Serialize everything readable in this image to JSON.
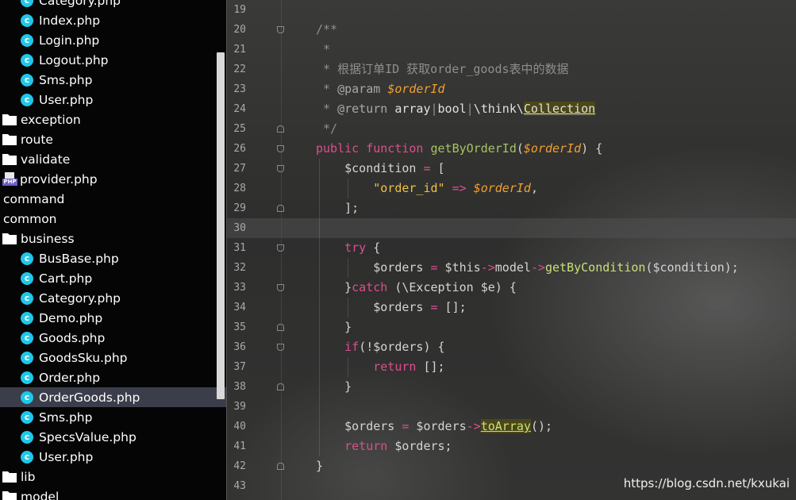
{
  "sidebar": {
    "items": [
      {
        "label": "Category.php",
        "icon": "class-file-icon"
      },
      {
        "label": "Index.php",
        "icon": "class-file-icon"
      },
      {
        "label": "Login.php",
        "icon": "class-file-icon"
      },
      {
        "label": "Logout.php",
        "icon": "class-file-icon"
      },
      {
        "label": "Sms.php",
        "icon": "class-file-icon"
      },
      {
        "label": "User.php",
        "icon": "class-file-icon"
      },
      {
        "label": "exception",
        "icon": "folder-icon"
      },
      {
        "label": "route",
        "icon": "folder-icon"
      },
      {
        "label": "validate",
        "icon": "folder-icon"
      },
      {
        "label": "provider.php",
        "icon": "php-file-icon"
      },
      {
        "label": "command",
        "icon": ""
      },
      {
        "label": "common",
        "icon": ""
      },
      {
        "label": "business",
        "icon": "folder-icon"
      },
      {
        "label": "BusBase.php",
        "icon": "class-file-icon"
      },
      {
        "label": "Cart.php",
        "icon": "class-file-icon"
      },
      {
        "label": "Category.php",
        "icon": "class-file-icon"
      },
      {
        "label": "Demo.php",
        "icon": "class-file-icon"
      },
      {
        "label": "Goods.php",
        "icon": "class-file-icon"
      },
      {
        "label": "GoodsSku.php",
        "icon": "class-file-icon"
      },
      {
        "label": "Order.php",
        "icon": "class-file-icon"
      },
      {
        "label": "OrderGoods.php",
        "icon": "class-file-icon",
        "selected": true
      },
      {
        "label": "Sms.php",
        "icon": "class-file-icon"
      },
      {
        "label": "SpecsValue.php",
        "icon": "class-file-icon"
      },
      {
        "label": "User.php",
        "icon": "class-file-icon"
      },
      {
        "label": "lib",
        "icon": "folder-icon"
      },
      {
        "label": "model",
        "icon": "folder-icon"
      }
    ],
    "icon_glyph_class": "c",
    "icon_glyph_php": "PHP"
  },
  "editor": {
    "current_line": "30",
    "lines": [
      {
        "num": "19",
        "text": ""
      },
      {
        "num": "20",
        "text": "/**"
      },
      {
        "num": "21",
        "text": " *"
      },
      {
        "num": "22",
        "text": " * 根据订单ID 获取order_goods表中的数据"
      },
      {
        "num": "23",
        "text": " * @param $orderId"
      },
      {
        "num": "24",
        "text": " * @return array|bool|\\think\\Collection"
      },
      {
        "num": "25",
        "text": " */"
      },
      {
        "num": "26",
        "text": "public function getByOrderId($orderId) {"
      },
      {
        "num": "27",
        "text": "    $condition = ["
      },
      {
        "num": "28",
        "text": "        \"order_id\" => $orderId,"
      },
      {
        "num": "29",
        "text": "    ];"
      },
      {
        "num": "30",
        "text": ""
      },
      {
        "num": "31",
        "text": "    try {"
      },
      {
        "num": "32",
        "text": "        $orders = $this->model->getByCondition($condition);"
      },
      {
        "num": "33",
        "text": "    }catch (\\Exception $e) {"
      },
      {
        "num": "34",
        "text": "        $orders = [];"
      },
      {
        "num": "35",
        "text": "    }"
      },
      {
        "num": "36",
        "text": "    if(!$orders) {"
      },
      {
        "num": "37",
        "text": "        return [];"
      },
      {
        "num": "38",
        "text": "    }"
      },
      {
        "num": "39",
        "text": ""
      },
      {
        "num": "40",
        "text": "    $orders = $orders->toArray();"
      },
      {
        "num": "41",
        "text": "    return $orders;"
      },
      {
        "num": "42",
        "text": "}"
      },
      {
        "num": "43",
        "text": ""
      }
    ]
  },
  "watermark": "https://blog.csdn.net/kxukai",
  "colors": {
    "sidebar_bg": "#050505",
    "selected_row": "#3b3e4a",
    "class_icon": "#1ec8ea",
    "keyword": "#d9508e",
    "function": "#a5c261",
    "param": "#f0a030",
    "string": "#f0c040",
    "comment": "#8f8f8f"
  }
}
